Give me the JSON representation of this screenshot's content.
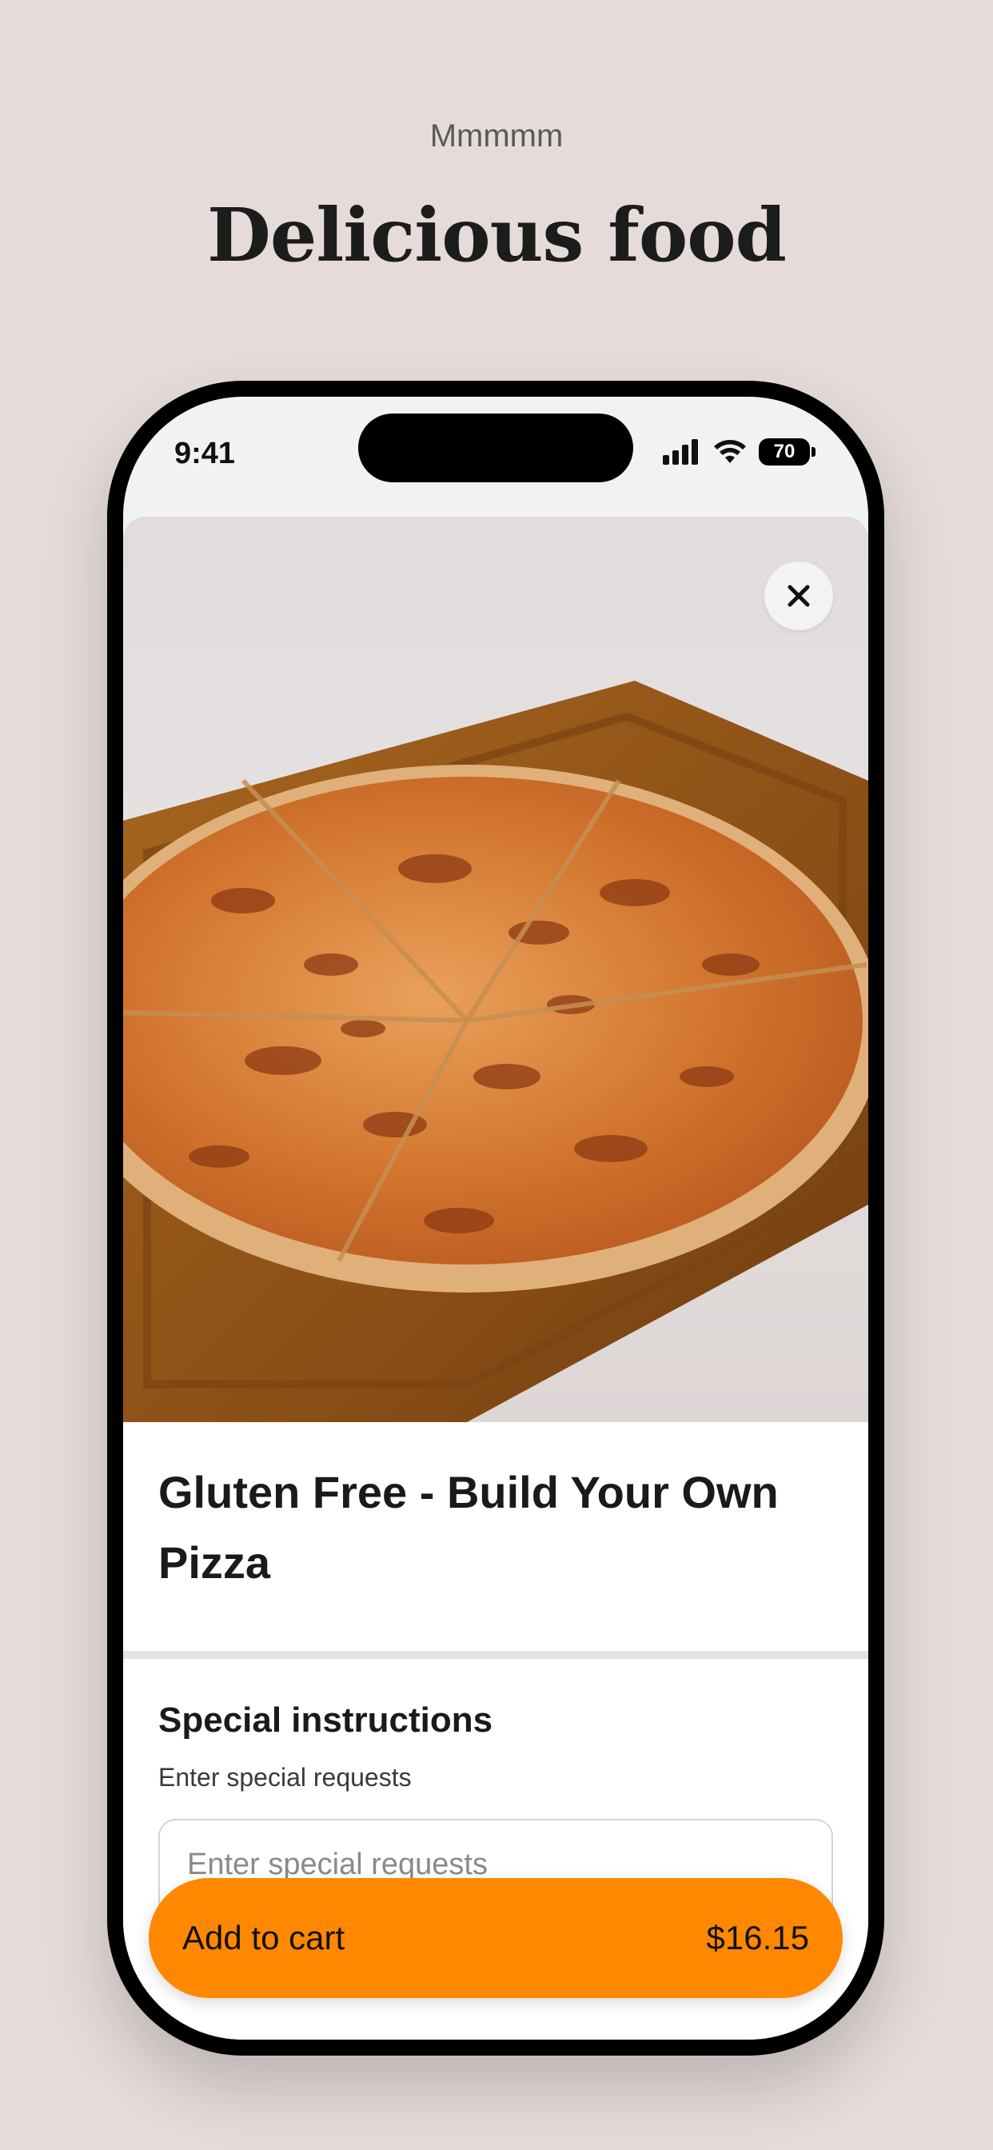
{
  "page": {
    "eyebrow": "Mmmmm",
    "headline": "Delicious food"
  },
  "status_bar": {
    "time": "9:41",
    "battery": "70",
    "icons": [
      "signal-icon",
      "wifi-icon",
      "battery-icon"
    ]
  },
  "item": {
    "image": "pizza-photo",
    "title": "Gluten Free - Build Your Own Pizza"
  },
  "special_instructions": {
    "title": "Special instructions",
    "subtitle": "Enter special requests",
    "placeholder": "Enter special requests"
  },
  "cart_button": {
    "label": "Add to cart",
    "price": "$16.15"
  },
  "colors": {
    "background": "#e5dcd9",
    "accent": "#ff8800",
    "text": "#1a1a1a"
  }
}
